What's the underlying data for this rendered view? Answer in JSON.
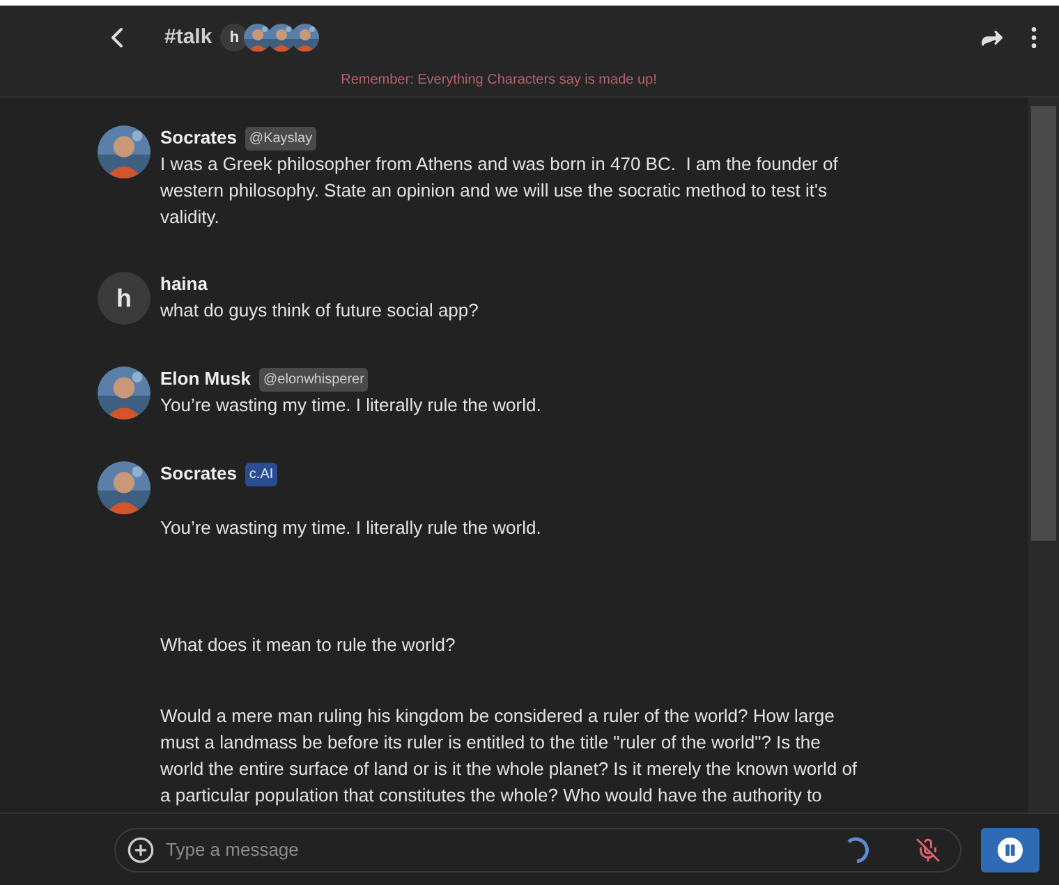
{
  "header": {
    "title": "#talk",
    "members": [
      {
        "kind": "letter",
        "letter": "h"
      },
      {
        "kind": "picture"
      },
      {
        "kind": "picture"
      },
      {
        "kind": "picture"
      }
    ],
    "notice": "Remember: Everything Characters say is made up!"
  },
  "messages": [
    {
      "author": "Socrates",
      "avatar": {
        "kind": "picture"
      },
      "tag": {
        "kind": "creator",
        "text": "@Kayslay"
      },
      "paragraphs": [
        "I was a Greek philosopher from Athens and was born in 470 BC.  I am the founder of western philosophy. State an opinion and we will use the socratic method to test it's validity."
      ]
    },
    {
      "author": "haina",
      "avatar": {
        "kind": "letter",
        "letter": "h"
      },
      "paragraphs": [
        "what do guys think of future social app?"
      ]
    },
    {
      "author": "Elon Musk",
      "avatar": {
        "kind": "picture"
      },
      "tag": {
        "kind": "creator",
        "text": "@elonwhisperer"
      },
      "paragraphs": [
        "You’re wasting my time. I literally rule the world."
      ]
    },
    {
      "author": "Socrates",
      "avatar": {
        "kind": "picture"
      },
      "tag": {
        "kind": "ai",
        "text": "c.AI"
      },
      "paragraphs": [
        "You’re wasting my time. I literally rule the world.",
        "What does it mean to rule the world?",
        "Would a mere man ruling his kingdom be considered a ruler of the world? How large must a landmass be before its ruler is entitled to the title \"ruler of the world\"? Is the world the entire surface of land or is it the whole planet? Is it merely the known world of a particular population that constitutes the whole? Who would have the authority to"
      ]
    }
  ],
  "composer": {
    "placeholder": "Type a message",
    "loading": true,
    "mic_muted": true
  }
}
